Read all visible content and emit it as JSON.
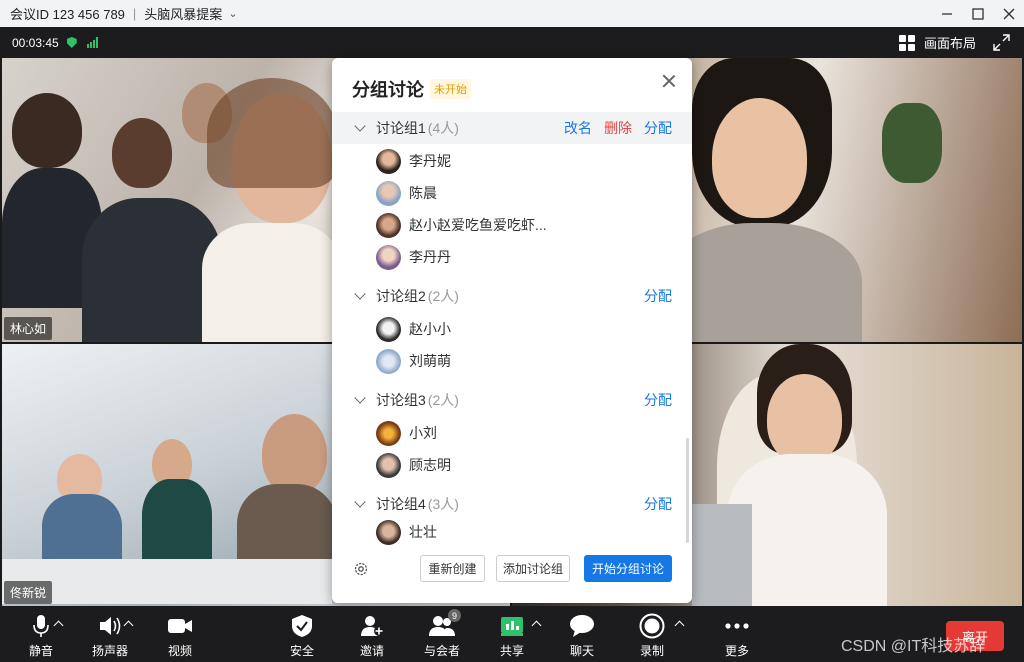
{
  "window": {
    "meeting_id": "会议ID 123 456 789",
    "separator": "|",
    "meeting_topic": "头脑风暴提案"
  },
  "infobar": {
    "timer": "00:03:45",
    "layout_label": "画面布局"
  },
  "videos": [
    {
      "name": "林心如"
    },
    {
      "name": ""
    },
    {
      "name": "佟新锐"
    },
    {
      "name": ""
    }
  ],
  "panel": {
    "title": "分组讨论",
    "status": "未开始",
    "groups": [
      {
        "name": "讨论组1",
        "count": "(4人)",
        "actions": {
          "rename": "改名",
          "delete": "删除",
          "assign": "分配"
        },
        "members": [
          "李丹妮",
          "陈晨",
          "赵小赵爱吃鱼爱吃虾...",
          "李丹丹"
        ]
      },
      {
        "name": "讨论组2",
        "count": "(2人)",
        "actions": {
          "assign": "分配"
        },
        "members": [
          "赵小小",
          "刘萌萌"
        ]
      },
      {
        "name": "讨论组3",
        "count": "(2人)",
        "actions": {
          "assign": "分配"
        },
        "members": [
          "小刘",
          "顾志明"
        ]
      },
      {
        "name": "讨论组4",
        "count": "(3人)",
        "actions": {
          "assign": "分配"
        },
        "members": [
          "壮壮"
        ]
      }
    ],
    "footer": {
      "recreate": "重新创建",
      "add_group": "添加讨论组",
      "start": "开始分组讨论"
    }
  },
  "toolbar": {
    "mute": "静音",
    "speaker": "扬声器",
    "video": "视频",
    "security": "安全",
    "invite": "邀请",
    "participants": "与会者",
    "participants_count": "9",
    "share": "共享",
    "chat": "聊天",
    "record": "录制",
    "more": "更多",
    "leave": "离开"
  },
  "watermark": "CSDN @IT科技苏辞",
  "colors": {
    "accent": "#1677e6",
    "danger": "#e64545",
    "status_pending": "#e0a000",
    "toolbar_bg": "#1c1c1e"
  }
}
